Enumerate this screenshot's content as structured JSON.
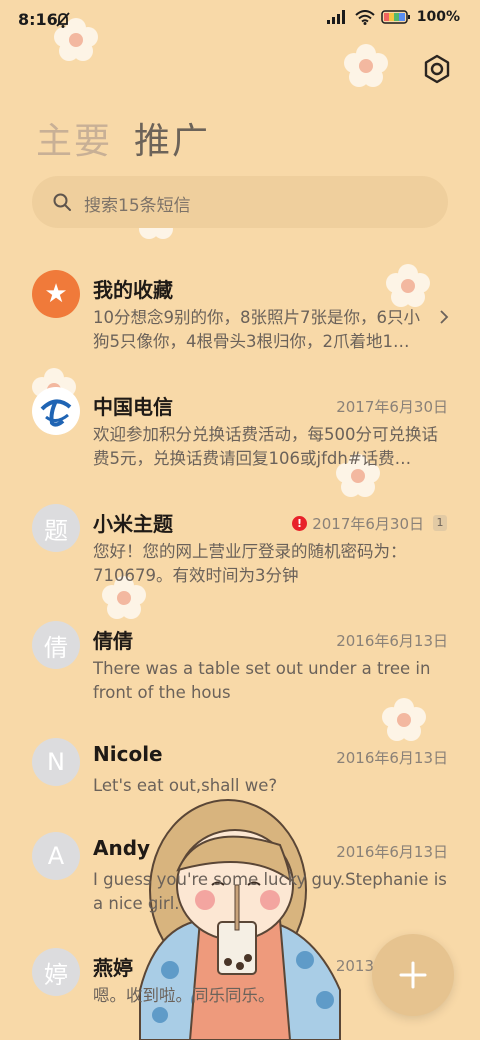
{
  "status_bar": {
    "time": "8:16",
    "battery_percent": "100%",
    "mute_icon": "bell-off-icon",
    "signal_icon": "signal-icon",
    "wifi_icon": "wifi-icon",
    "battery_icon": "battery-icon"
  },
  "header": {
    "settings_icon": "gear-icon",
    "tabs": [
      {
        "label": "主要",
        "active": false
      },
      {
        "label": "推广",
        "active": true
      }
    ]
  },
  "search": {
    "placeholder": "搜索15条短信",
    "icon": "search-icon"
  },
  "conversations": [
    {
      "name": "我的收藏",
      "date": "",
      "preview": "10分想念9别的你，8张照片7张是你，6只小狗5只像你，4根骨头3根归你，2爪着地1…",
      "avatar": "★",
      "avatar_kind": "star",
      "avatar_color": "#f07a3a"
    },
    {
      "name": "中国电信",
      "date": "2017年6月30日",
      "preview": "欢迎参加积分兑换话费活动，每500分可兑换话费5元，兑换话费请回复106或jfdh#话费…",
      "avatar": "",
      "avatar_kind": "logo",
      "avatar_color": "#ffffff"
    },
    {
      "name": "小米主题",
      "date": "2017年6月30日",
      "preview": "您好！您的网上营业厅登录的随机密码为：710679。有效时间为3分钟",
      "avatar": "题",
      "avatar_kind": "letter",
      "unread_count": "1",
      "has_warning": true
    },
    {
      "name": "倩倩",
      "date": "2016年6月13日",
      "preview": "There was a table set out under a tree in front of the hous",
      "avatar": "倩",
      "avatar_kind": "letter"
    },
    {
      "name": "Nicole",
      "date": "2016年6月13日",
      "preview": "Let's eat out,shall we?",
      "avatar": "N",
      "avatar_kind": "letter"
    },
    {
      "name": "Andy",
      "date": "2016年6月13日",
      "preview": "I guess you're some lucky guy.Stephanie is a nice girl.",
      "avatar": "A",
      "avatar_kind": "letter"
    },
    {
      "name": "燕婷",
      "date": "2013",
      "preview": "嗯。收到啦。同乐同乐。",
      "avatar": "婷",
      "avatar_kind": "letter"
    }
  ],
  "fab": {
    "icon": "plus-icon"
  },
  "colors": {
    "background": "#f8d9a8",
    "search_bg": "#efcf9d",
    "fab_bg": "#e6c38f",
    "favorite_orange": "#f07a3a",
    "warning_red": "#e8222a"
  }
}
